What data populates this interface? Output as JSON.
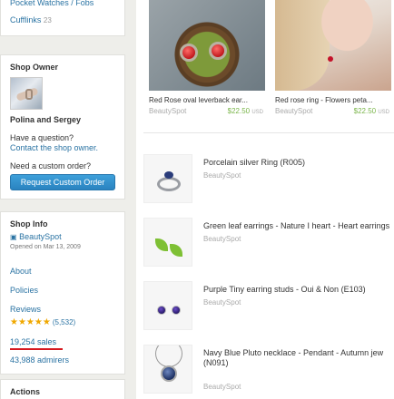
{
  "sidebar": {
    "categories": {
      "cut_off_item": "Pocket Watches / Fobs",
      "cufflinks_label": "Cufflinks",
      "cufflinks_count": "23"
    },
    "shop_owner": {
      "heading": "Shop Owner",
      "owner_name": "Polina and Sergey",
      "question_label": "Have a question?",
      "contact_link": "Contact the shop owner.",
      "custom_order_label": "Need a custom order?",
      "request_button": "Request Custom Order"
    },
    "shop_info": {
      "heading": "Shop Info",
      "shop_name": "BeautySpot",
      "opened": "Opened on Mar 13, 2009",
      "about": "About",
      "policies": "Policies",
      "reviews_label": "Reviews",
      "stars": "★★★★★",
      "rating_value": 5,
      "reviews_count": "(5,532)",
      "sales": "19,254 sales",
      "admirers": "43,988 admirers"
    },
    "actions": {
      "heading": "Actions"
    }
  },
  "featured": [
    {
      "title": "Red Rose oval leverback ear...",
      "shop": "BeautySpot",
      "price": "$22.50",
      "currency": "USD"
    },
    {
      "title": "Red rose ring - Flowers peta...",
      "shop": "BeautySpot",
      "price": "$22.50",
      "currency": "USD"
    }
  ],
  "listings": [
    {
      "title": "Porcelain silver Ring (R005)",
      "shop": "BeautySpot"
    },
    {
      "title": "Green leaf earrings - Nature I heart - Heart earrings",
      "shop": "BeautySpot"
    },
    {
      "title": "Purple Tiny earring studs - Oui & Non (E103)",
      "shop": "BeautySpot"
    },
    {
      "title": "Navy Blue Pluto necklace - Pendant - Autumn jew (N091)",
      "shop": "BeautySpot"
    }
  ],
  "colors": {
    "link": "#2a73a3",
    "button": "#2a83c0",
    "price": "#7ab54a",
    "star": "#f0a800",
    "sales_underline": "#d6181f"
  }
}
